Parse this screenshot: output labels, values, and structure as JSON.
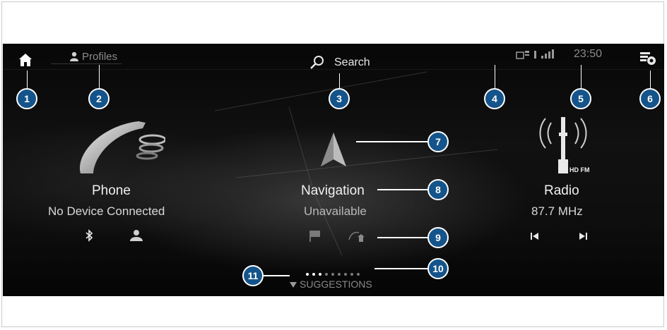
{
  "header": {
    "profiles_label": "Profiles",
    "search_label": "Search",
    "clock": "23:50"
  },
  "tiles": {
    "phone": {
      "title": "Phone",
      "subtitle": "No Device Connected"
    },
    "navigation": {
      "title": "Navigation",
      "subtitle": "Unavailable"
    },
    "radio": {
      "title": "Radio",
      "subtitle": "87.7 MHz",
      "badge": "HD FM"
    }
  },
  "suggestions_label": "SUGGESTIONS",
  "page_indicator": {
    "count": 9,
    "active": 2
  },
  "callouts": [
    "1",
    "2",
    "3",
    "4",
    "5",
    "6",
    "7",
    "8",
    "9",
    "10",
    "11"
  ],
  "colors": {
    "callout_fill": "#14548a",
    "background": "#0a0a0a",
    "text": "#e8e8e8"
  },
  "icons": [
    "home-icon",
    "profile-icon",
    "search-icon",
    "sim-card-icon",
    "signal-icon",
    "notification-settings-icon",
    "phone-handset-icon",
    "navigation-arrow-icon",
    "radio-tower-icon",
    "bluetooth-icon",
    "contacts-icon",
    "destination-flag-icon",
    "home-route-icon",
    "previous-track-icon",
    "next-track-icon",
    "suggestions-arrow-icon"
  ]
}
